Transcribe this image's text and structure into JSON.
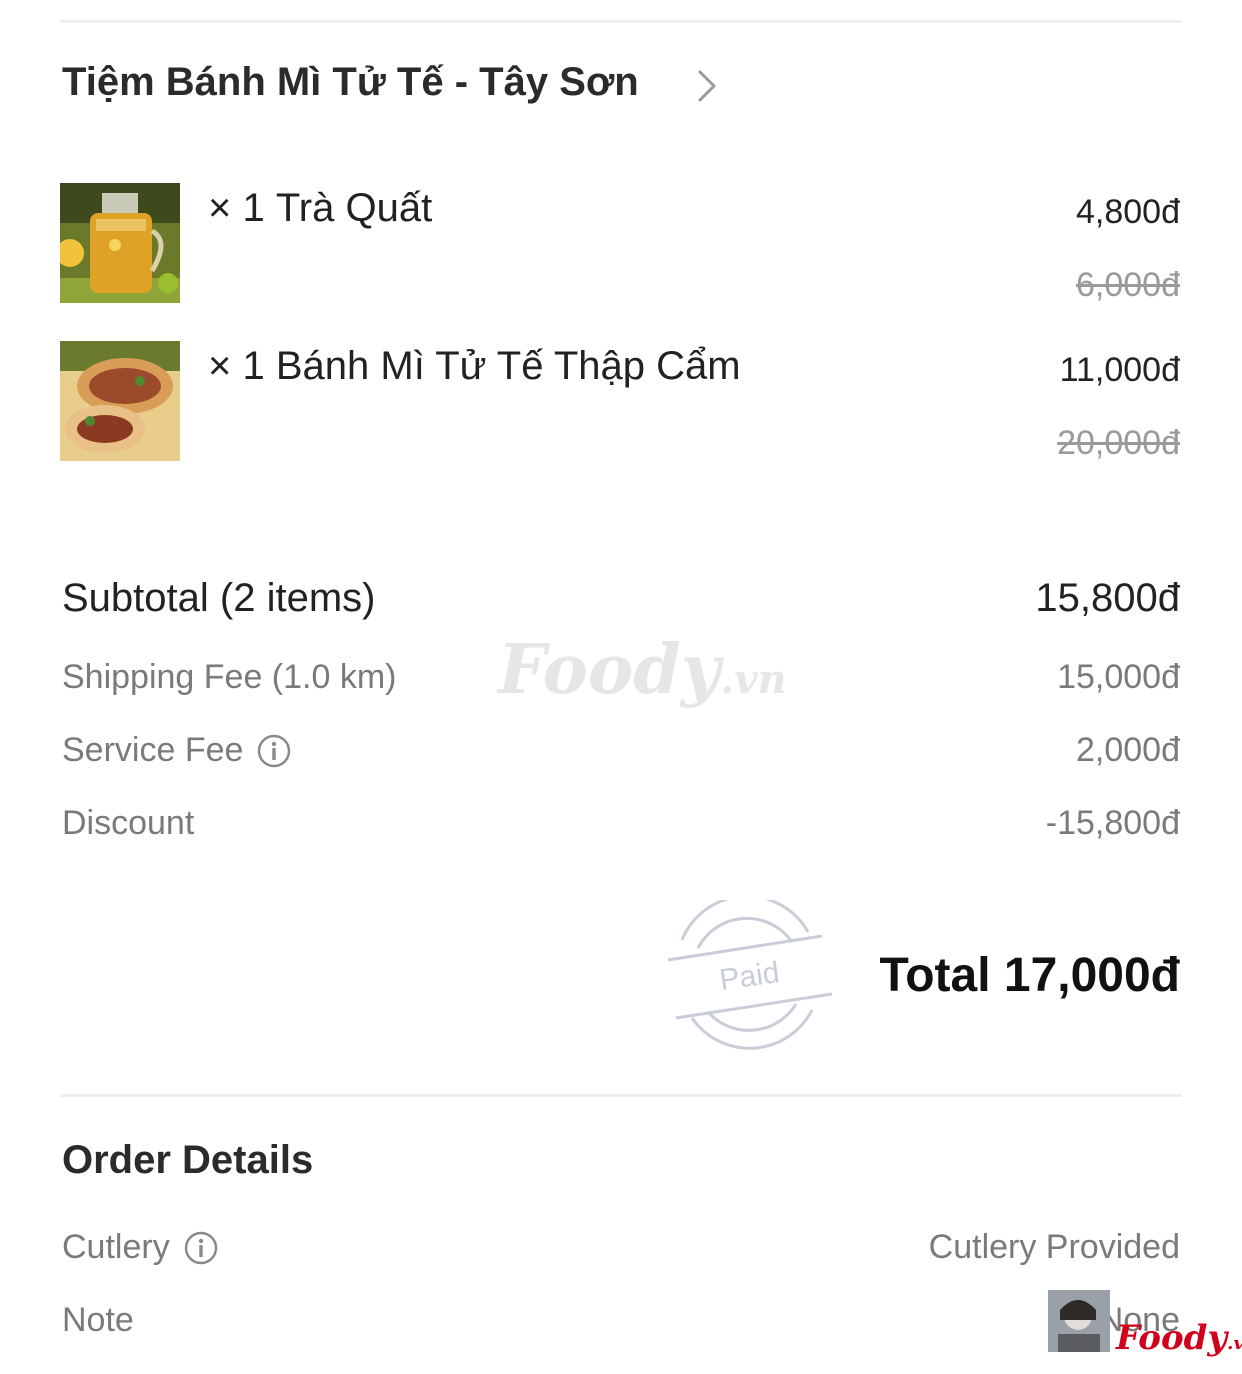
{
  "shop": {
    "name": "Tiệm Bánh Mì Tử Tế - Tây Sơn"
  },
  "items": [
    {
      "qty_label": "× 1",
      "name": "Trà Quất",
      "price": "4,800đ",
      "original_price": "6,000đ"
    },
    {
      "qty_label": "× 1",
      "name": "Bánh Mì Tử Tế Thập Cẩm",
      "price": "11,000đ",
      "original_price": "20,000đ"
    }
  ],
  "summary": {
    "subtotal_label": "Subtotal (2 items)",
    "subtotal_value": "15,800đ",
    "shipping_label": "Shipping Fee (1.0 km)",
    "shipping_value": "15,000đ",
    "service_label": "Service Fee",
    "service_value": "2,000đ",
    "discount_label": "Discount",
    "discount_value": "-15,800đ",
    "total": "Total 17,000đ",
    "stamp": "Paid"
  },
  "order_details": {
    "title": "Order Details",
    "cutlery_label": "Cutlery",
    "cutlery_value": "Cutlery Provided",
    "note_label": "Note",
    "note_value": "None"
  },
  "watermark": {
    "brand": "Foody",
    "suffix": ".vn"
  },
  "icons": {
    "chevron": "chevron-right-icon",
    "info": "info-icon"
  },
  "colors": {
    "muted_text": "#7a7a7a",
    "strike_text": "#9a9a9a",
    "stamp": "#c8cdd8",
    "brand_red": "#d0021b"
  }
}
